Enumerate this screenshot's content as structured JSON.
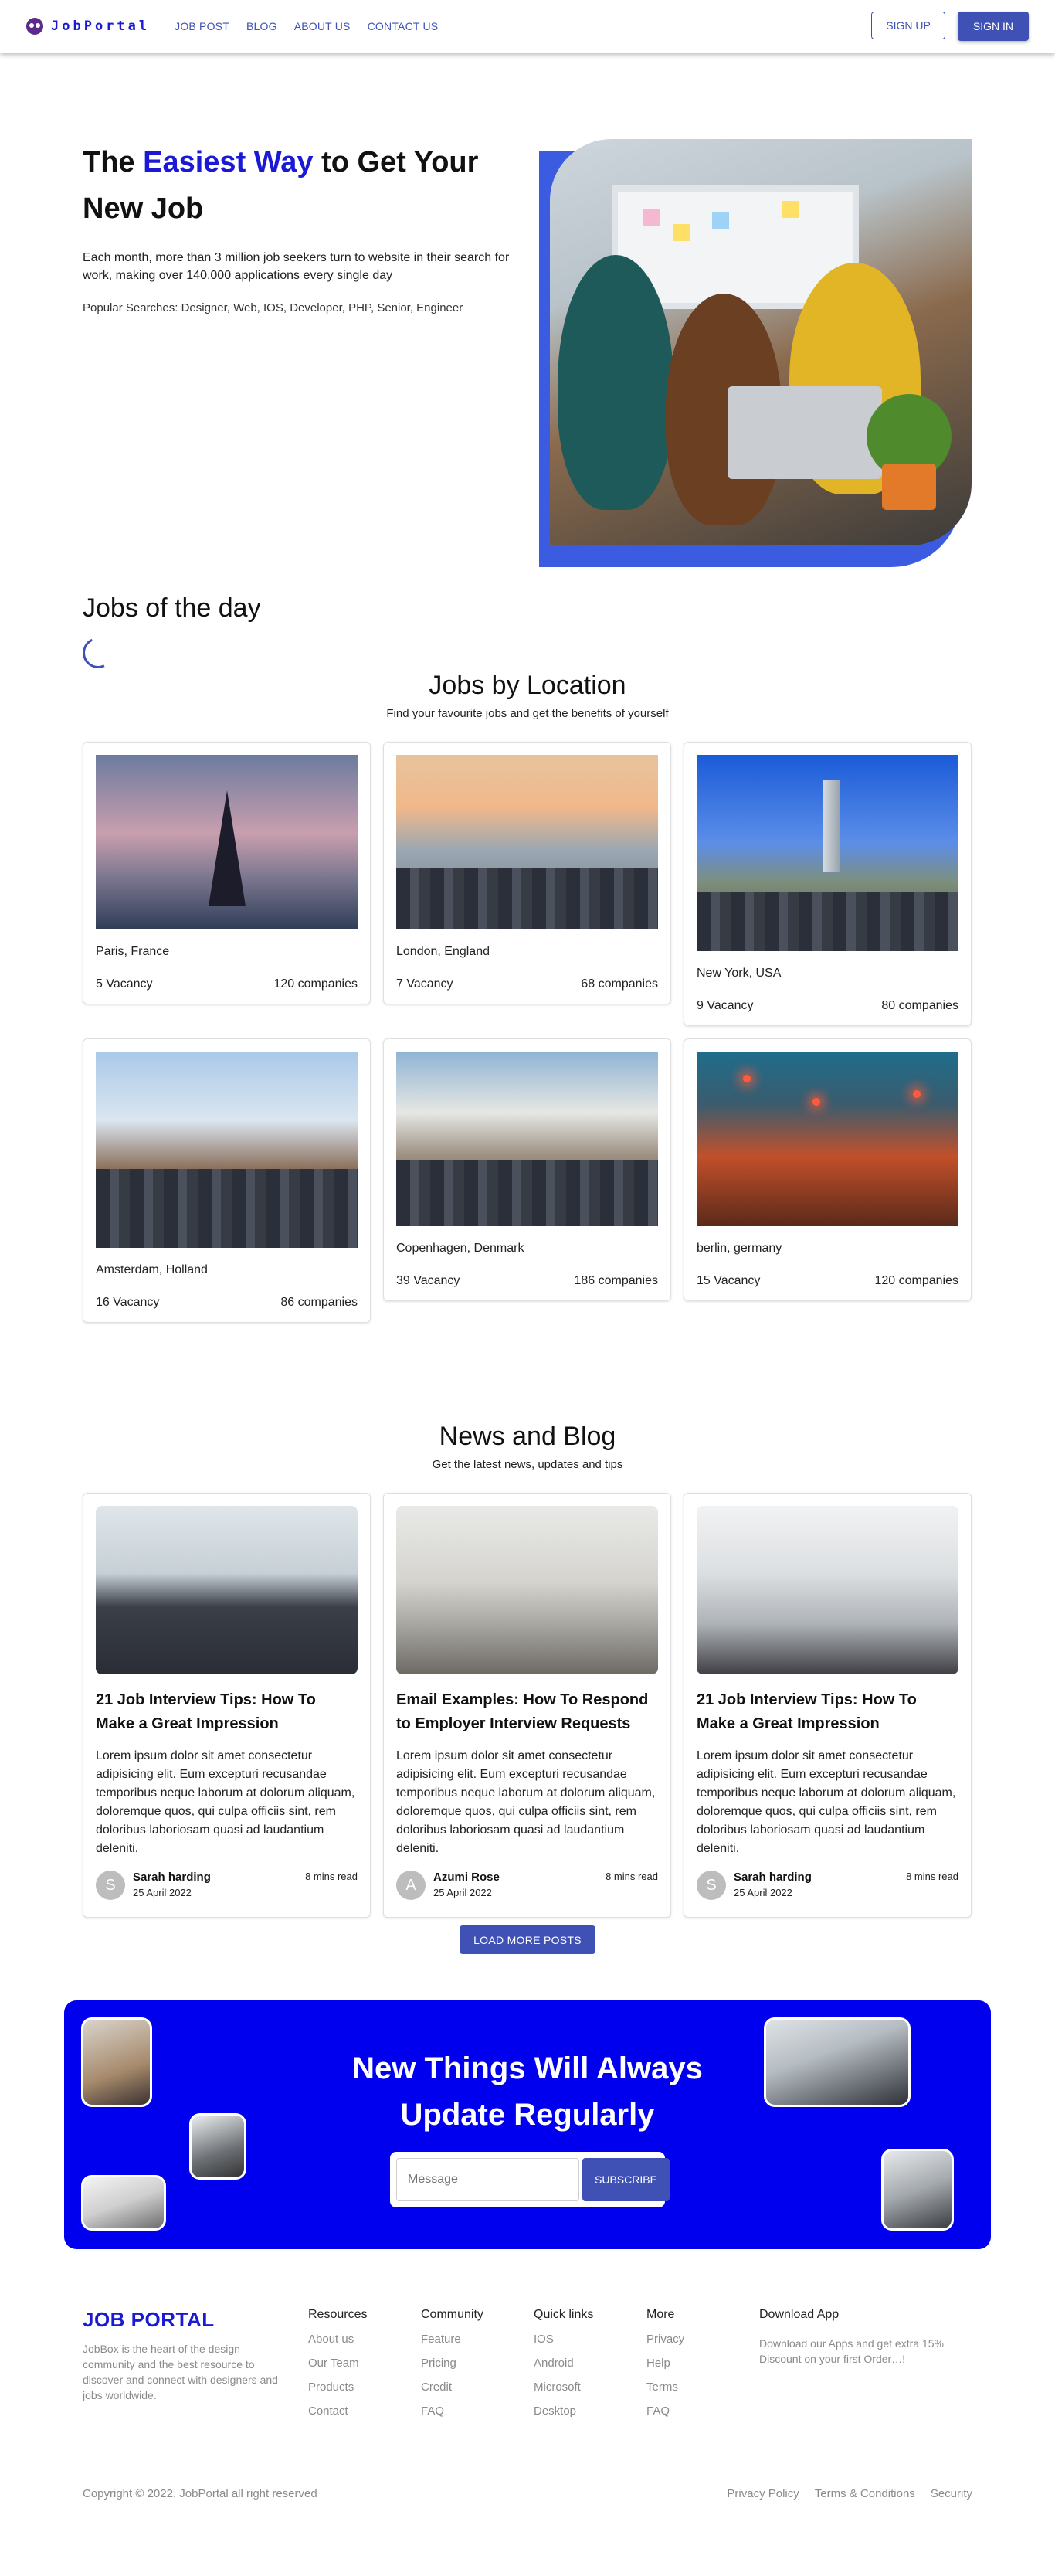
{
  "nav": {
    "logo": "JobPortal",
    "links": [
      "JOB POST",
      "BLOG",
      "ABOUT US",
      "CONTACT US"
    ],
    "signup": "SIGN UP",
    "signin": "SIGN IN"
  },
  "hero": {
    "title_pre": "The ",
    "title_accent": "Easiest Way",
    "title_post": " to Get Your New Job",
    "description": "Each month, more than 3 million job seekers turn to website in their search for work, making over 140,000 applications every single day",
    "popular": "Popular Searches: Designer, Web, IOS, Developer, PHP, Senior, Engineer"
  },
  "jobs_of_day": {
    "title": "Jobs of the day"
  },
  "locations": {
    "title": "Jobs by Location",
    "subtitle": "Find your favourite jobs and get the benefits of yourself",
    "items": [
      {
        "name": "Paris, France",
        "vacancy": "5 Vacancy",
        "companies": "120 companies"
      },
      {
        "name": "London, England",
        "vacancy": "7 Vacancy",
        "companies": "68 companies"
      },
      {
        "name": "New York, USA",
        "vacancy": "9 Vacancy",
        "companies": "80 companies"
      },
      {
        "name": "Amsterdam, Holland",
        "vacancy": "16 Vacancy",
        "companies": "86 companies"
      },
      {
        "name": "Copenhagen, Denmark",
        "vacancy": "39 Vacancy",
        "companies": "186 companies"
      },
      {
        "name": "berlin, germany",
        "vacancy": "15 Vacancy",
        "companies": "120 companies"
      }
    ]
  },
  "news": {
    "title": "News and Blog",
    "subtitle": "Get the latest news, updates and tips",
    "posts": [
      {
        "title": "21 Job Interview Tips: How To Make a Great Impression",
        "body": "Lorem ipsum dolor sit amet consectetur adipisicing elit. Eum excepturi recusandae temporibus neque laborum at dolorum aliquam, doloremque quos, qui culpa officiis sint, rem doloribus laboriosam quasi ad laudantium deleniti.",
        "author": "Sarah harding",
        "initial": "S",
        "date": "25 April 2022",
        "read": "8 mins read"
      },
      {
        "title": "Email Examples: How To Respond to Employer Interview Requests",
        "body": "Lorem ipsum dolor sit amet consectetur adipisicing elit. Eum excepturi recusandae temporibus neque laborum at dolorum aliquam, doloremque quos, qui culpa officiis sint, rem doloribus laboriosam quasi ad laudantium deleniti.",
        "author": "Azumi Rose",
        "initial": "A",
        "date": "25 April 2022",
        "read": "8 mins read"
      },
      {
        "title": "21 Job Interview Tips: How To Make a Great Impression",
        "body": "Lorem ipsum dolor sit amet consectetur adipisicing elit. Eum excepturi recusandae temporibus neque laborum at dolorum aliquam, doloremque quos, qui culpa officiis sint, rem doloribus laboriosam quasi ad laudantium deleniti.",
        "author": "Sarah harding",
        "initial": "S",
        "date": "25 April 2022",
        "read": "8 mins read"
      }
    ],
    "load_more": "LOAD MORE POSTS"
  },
  "newsletter": {
    "title_line1": "New Things Will Always",
    "title_line2": "Update Regularly",
    "placeholder": "Message",
    "button": "SUBSCRIBE",
    "color": "#0000ee"
  },
  "footer": {
    "logo": "JOB PORTAL",
    "description": "JobBox is the heart of the design community and the best resource to discover and connect with designers and jobs worldwide.",
    "columns": [
      {
        "title": "Resources",
        "items": [
          "About us",
          "Our Team",
          "Products",
          "Contact"
        ]
      },
      {
        "title": "Community",
        "items": [
          "Feature",
          "Pricing",
          "Credit",
          "FAQ"
        ]
      },
      {
        "title": "Quick links",
        "items": [
          "IOS",
          "Android",
          "Microsoft",
          "Desktop"
        ]
      },
      {
        "title": "More",
        "items": [
          "Privacy",
          "Help",
          "Terms",
          "FAQ"
        ]
      }
    ],
    "app_title": "Download App",
    "app_text": "Download our Apps and get extra 15% Discount on your first Order…!",
    "copyright": "Copyright © 2022. JobPortal all right reserved",
    "bottom_links": [
      "Privacy Policy",
      "Terms & Conditions",
      "Security"
    ]
  },
  "colors": {
    "accent": "#1a1ad6",
    "primary_button": "#3f51b5",
    "hero_frame": "#3b5be0"
  },
  "icons": {
    "logo": "owl-icon",
    "loading": "spinner-icon"
  }
}
